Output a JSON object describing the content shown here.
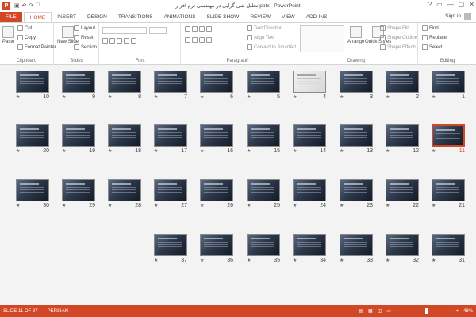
{
  "window": {
    "title": "تحلیل شی گرایی در مهندسی نرم افزار.pptx - PowerPoint",
    "app_icon": "P",
    "controls": [
      "?",
      "▭",
      "—",
      "▢",
      "✕"
    ],
    "signin": "Sign in"
  },
  "tabs": [
    "FILE",
    "HOME",
    "INSERT",
    "DESIGN",
    "TRANSITIONS",
    "ANIMATIONS",
    "SLIDE SHOW",
    "REVIEW",
    "VIEW",
    "ADD-INS"
  ],
  "active_tab": "HOME",
  "ribbon": {
    "clipboard": {
      "label": "Clipboard",
      "paste": "Paste",
      "cut": "Cut",
      "copy": "Copy",
      "format_painter": "Format Painter"
    },
    "slides": {
      "label": "Slides",
      "new_slide": "New Slide",
      "layout": "Layout",
      "reset": "Reset",
      "section": "Section"
    },
    "font": {
      "label": "Font"
    },
    "paragraph": {
      "label": "Paragraph",
      "text_direction": "Text Direction",
      "align_text": "Align Text",
      "convert_smartart": "Convert to SmartArt"
    },
    "drawing": {
      "label": "Drawing",
      "arrange": "Arrange",
      "quick_styles": "Quick Styles",
      "shape_fill": "Shape Fill",
      "shape_outline": "Shape Outline",
      "shape_effects": "Shape Effects"
    },
    "editing": {
      "label": "Editing",
      "find": "Find",
      "replace": "Replace",
      "select": "Select"
    }
  },
  "slides": [
    {
      "num": "10",
      "row": 0,
      "col": 0
    },
    {
      "num": "9",
      "row": 0,
      "col": 1
    },
    {
      "num": "8",
      "row": 0,
      "col": 2
    },
    {
      "num": "7",
      "row": 0,
      "col": 3
    },
    {
      "num": "6",
      "row": 0,
      "col": 4
    },
    {
      "num": "5",
      "row": 0,
      "col": 5
    },
    {
      "num": "4",
      "row": 0,
      "col": 6,
      "light": true
    },
    {
      "num": "3",
      "row": 0,
      "col": 7
    },
    {
      "num": "2",
      "row": 0,
      "col": 8
    },
    {
      "num": "1",
      "row": 0,
      "col": 9
    },
    {
      "num": "20",
      "row": 1,
      "col": 0
    },
    {
      "num": "19",
      "row": 1,
      "col": 1
    },
    {
      "num": "18",
      "row": 1,
      "col": 2
    },
    {
      "num": "17",
      "row": 1,
      "col": 3
    },
    {
      "num": "16",
      "row": 1,
      "col": 4
    },
    {
      "num": "15",
      "row": 1,
      "col": 5
    },
    {
      "num": "14",
      "row": 1,
      "col": 6
    },
    {
      "num": "13",
      "row": 1,
      "col": 7
    },
    {
      "num": "12",
      "row": 1,
      "col": 8
    },
    {
      "num": "11",
      "row": 1,
      "col": 9,
      "selected": true
    },
    {
      "num": "30",
      "row": 2,
      "col": 0
    },
    {
      "num": "29",
      "row": 2,
      "col": 1
    },
    {
      "num": "28",
      "row": 2,
      "col": 2
    },
    {
      "num": "27",
      "row": 2,
      "col": 3
    },
    {
      "num": "26",
      "row": 2,
      "col": 4
    },
    {
      "num": "25",
      "row": 2,
      "col": 5
    },
    {
      "num": "24",
      "row": 2,
      "col": 6
    },
    {
      "num": "23",
      "row": 2,
      "col": 7
    },
    {
      "num": "22",
      "row": 2,
      "col": 8
    },
    {
      "num": "21",
      "row": 2,
      "col": 9
    },
    {
      "num": "37",
      "row": 3,
      "col": 3
    },
    {
      "num": "36",
      "row": 3,
      "col": 4
    },
    {
      "num": "35",
      "row": 3,
      "col": 5
    },
    {
      "num": "34",
      "row": 3,
      "col": 6
    },
    {
      "num": "33",
      "row": 3,
      "col": 7
    },
    {
      "num": "32",
      "row": 3,
      "col": 8
    },
    {
      "num": "31",
      "row": 3,
      "col": 9
    }
  ],
  "status": {
    "slide_info": "SLIDE 11 OF 37",
    "language": "PERSIAN",
    "zoom": "48%",
    "zoom_fraction": 0.48
  },
  "colors": {
    "accent": "#d24726"
  }
}
